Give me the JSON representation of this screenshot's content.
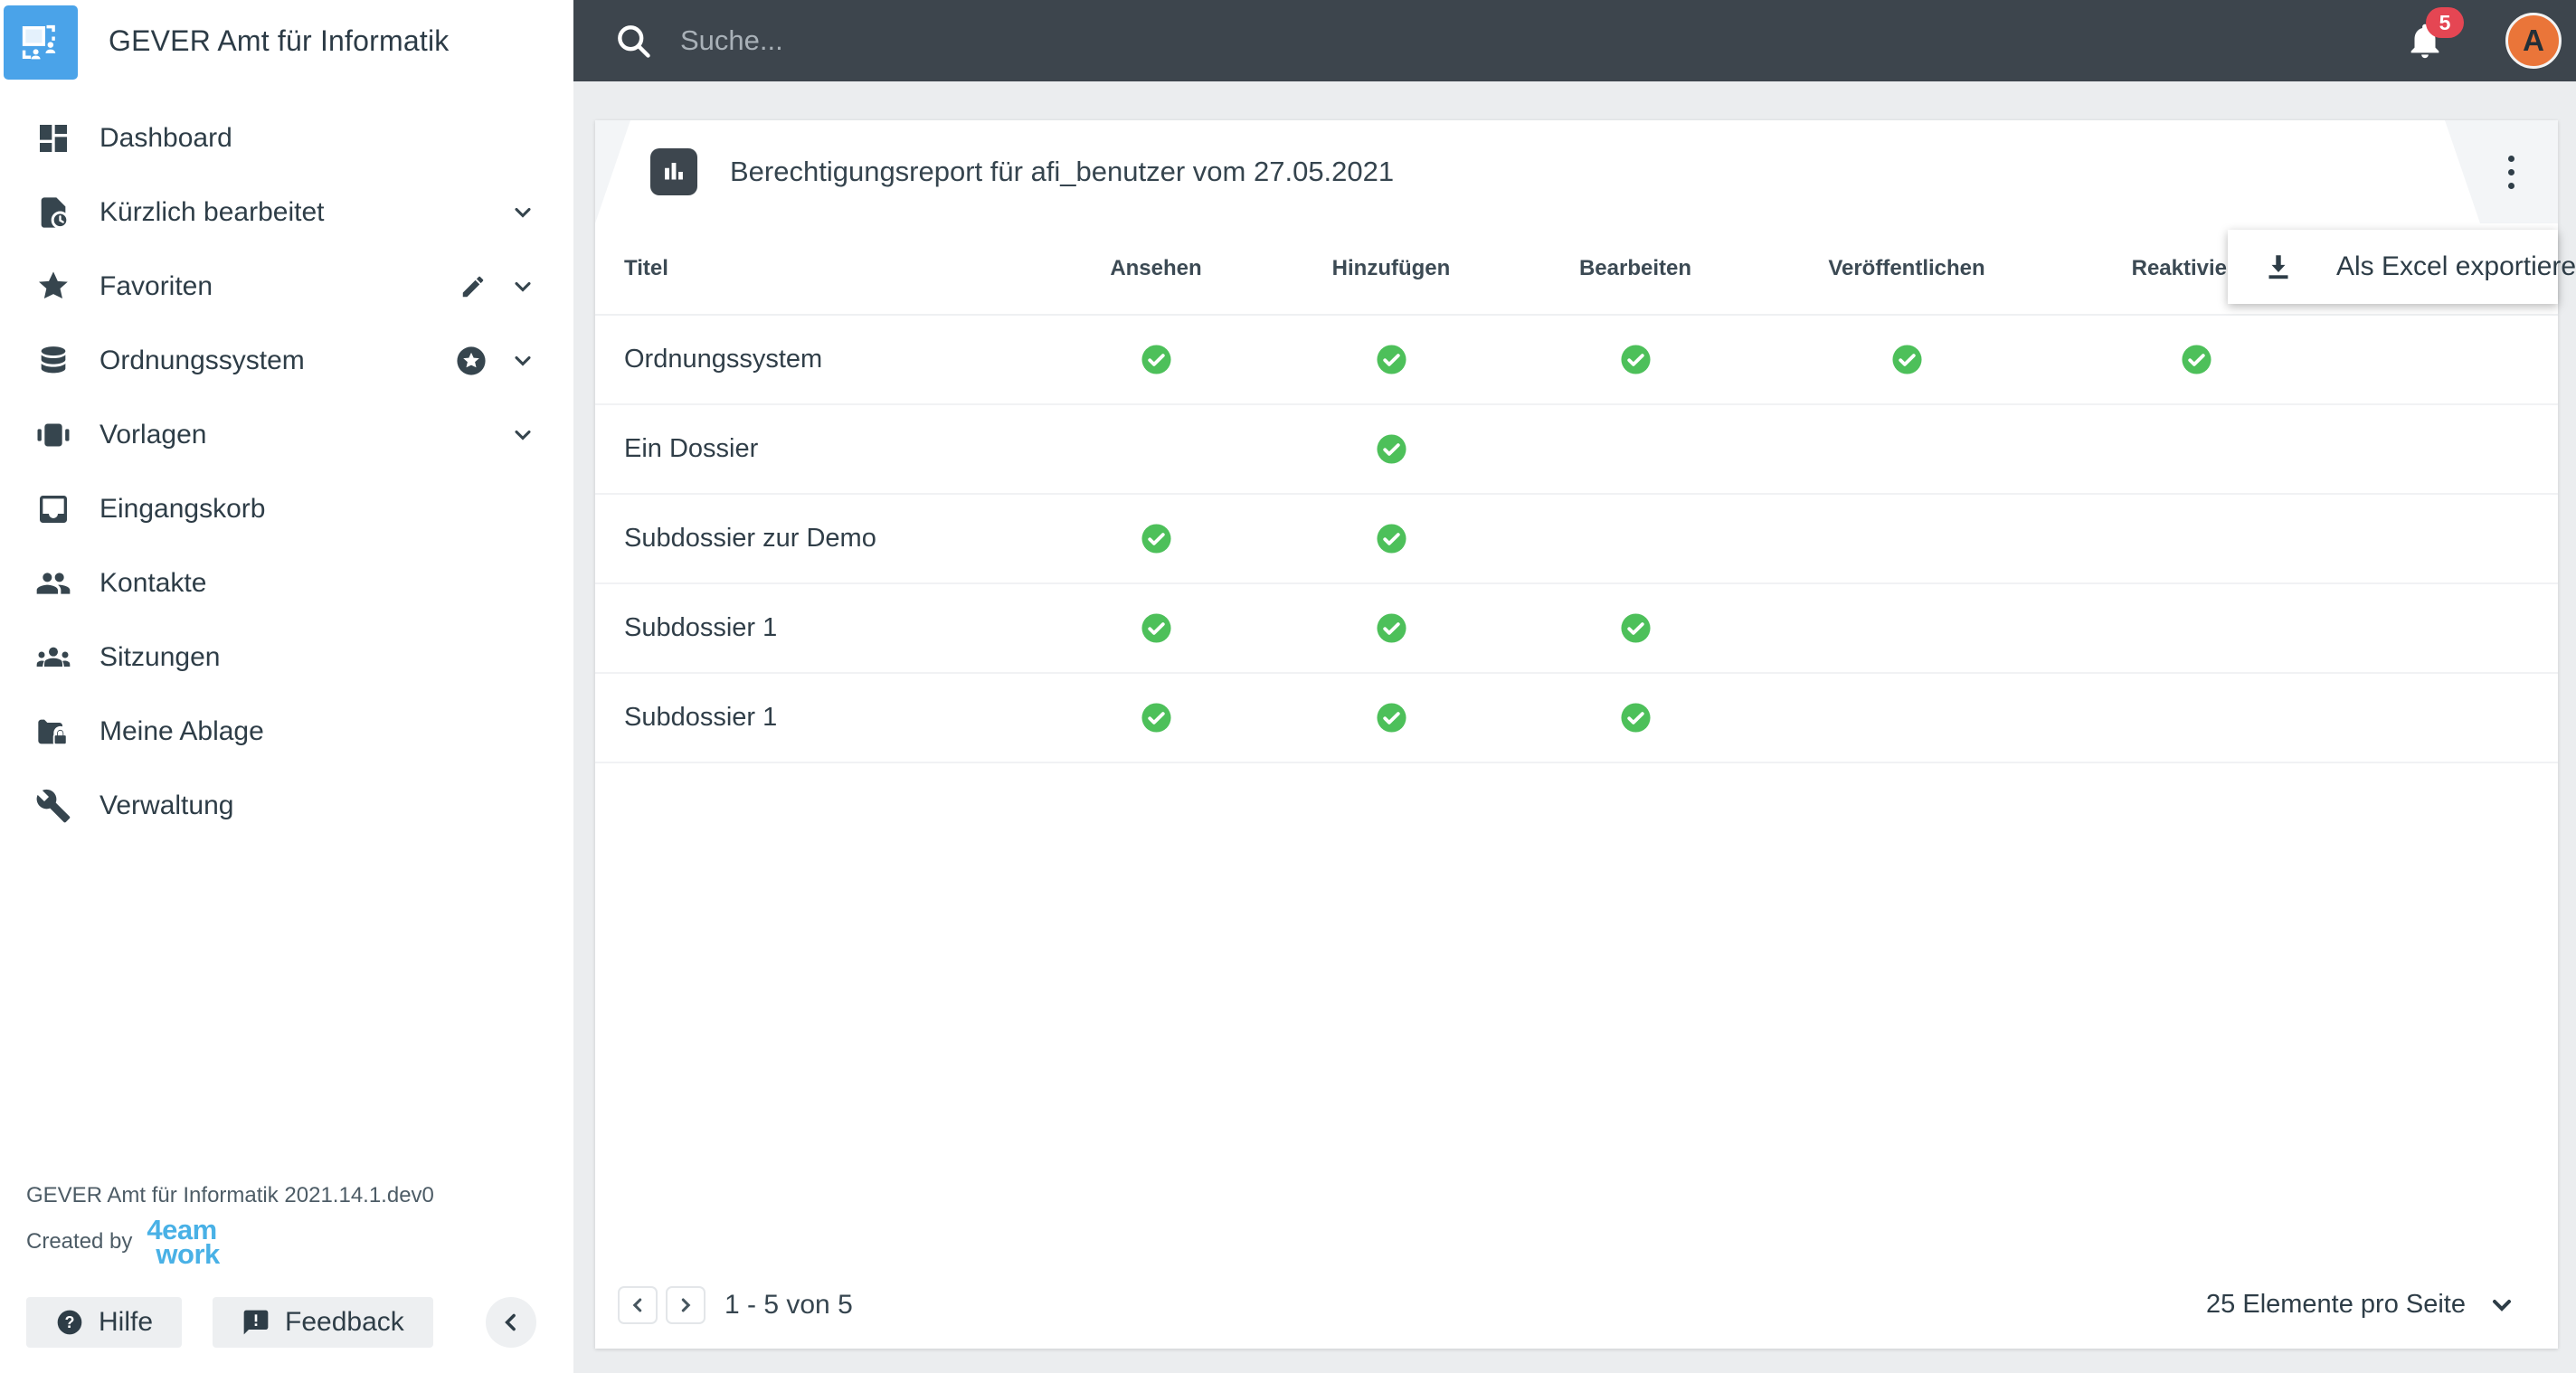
{
  "app": {
    "title": "GEVER Amt für Informatik"
  },
  "topbar": {
    "search_placeholder": "Suche...",
    "notification_count": "5",
    "avatar_letter": "A"
  },
  "sidebar": {
    "items": [
      {
        "label": "Dashboard",
        "icon": "dashboard-icon",
        "expandable": false
      },
      {
        "label": "Kürzlich bearbeitet",
        "icon": "recent-document-icon",
        "expandable": true
      },
      {
        "label": "Favoriten",
        "icon": "star-icon",
        "expandable": true,
        "extra": "edit-icon"
      },
      {
        "label": "Ordnungssystem",
        "icon": "database-icon",
        "expandable": true,
        "extra": "star-badge-icon"
      },
      {
        "label": "Vorlagen",
        "icon": "templates-icon",
        "expandable": true
      },
      {
        "label": "Eingangskorb",
        "icon": "inbox-icon",
        "expandable": false
      },
      {
        "label": "Kontakte",
        "icon": "contacts-icon",
        "expandable": false
      },
      {
        "label": "Sitzungen",
        "icon": "meetings-icon",
        "expandable": false
      },
      {
        "label": "Meine Ablage",
        "icon": "locked-folder-icon",
        "expandable": false
      },
      {
        "label": "Verwaltung",
        "icon": "wrench-icon",
        "expandable": false
      }
    ],
    "footer": {
      "version": "GEVER Amt für Informatik 2021.14.1.dev0",
      "created_by": "Created by",
      "brand_line1": "4eam",
      "brand_line2": "work",
      "help_label": "Hilfe",
      "feedback_label": "Feedback"
    }
  },
  "report": {
    "title": "Berechtigungsreport für afi_benutzer vom 27.05.2021",
    "menu": {
      "export_label": "Als Excel exportieren"
    },
    "table": {
      "columns": [
        "Titel",
        "Ansehen",
        "Hinzufügen",
        "Bearbeiten",
        "Veröffentlichen",
        "Reaktivieren"
      ],
      "rows": [
        {
          "title": "Ordnungssystem",
          "permissions": [
            true,
            true,
            true,
            true,
            true
          ]
        },
        {
          "title": "Ein Dossier",
          "permissions": [
            false,
            true,
            false,
            false,
            false
          ]
        },
        {
          "title": "Subdossier zur Demo",
          "permissions": [
            true,
            true,
            false,
            false,
            false
          ]
        },
        {
          "title": "Subdossier 1",
          "permissions": [
            true,
            true,
            true,
            false,
            false
          ]
        },
        {
          "title": "Subdossier 1",
          "permissions": [
            true,
            true,
            true,
            false,
            false
          ]
        }
      ]
    },
    "pagination": {
      "range_text": "1 - 5 von 5",
      "per_page_text": "25 Elemente pro Seite"
    }
  },
  "colors": {
    "topbar": "#3d454d",
    "page-bg": "#ebedef",
    "logo-blue": "#4aa3e9",
    "brand-blue": "#49b1e6",
    "badge-red": "#e54653",
    "avatar-orange": "#ea7539",
    "check-green": "#4dc05a"
  }
}
